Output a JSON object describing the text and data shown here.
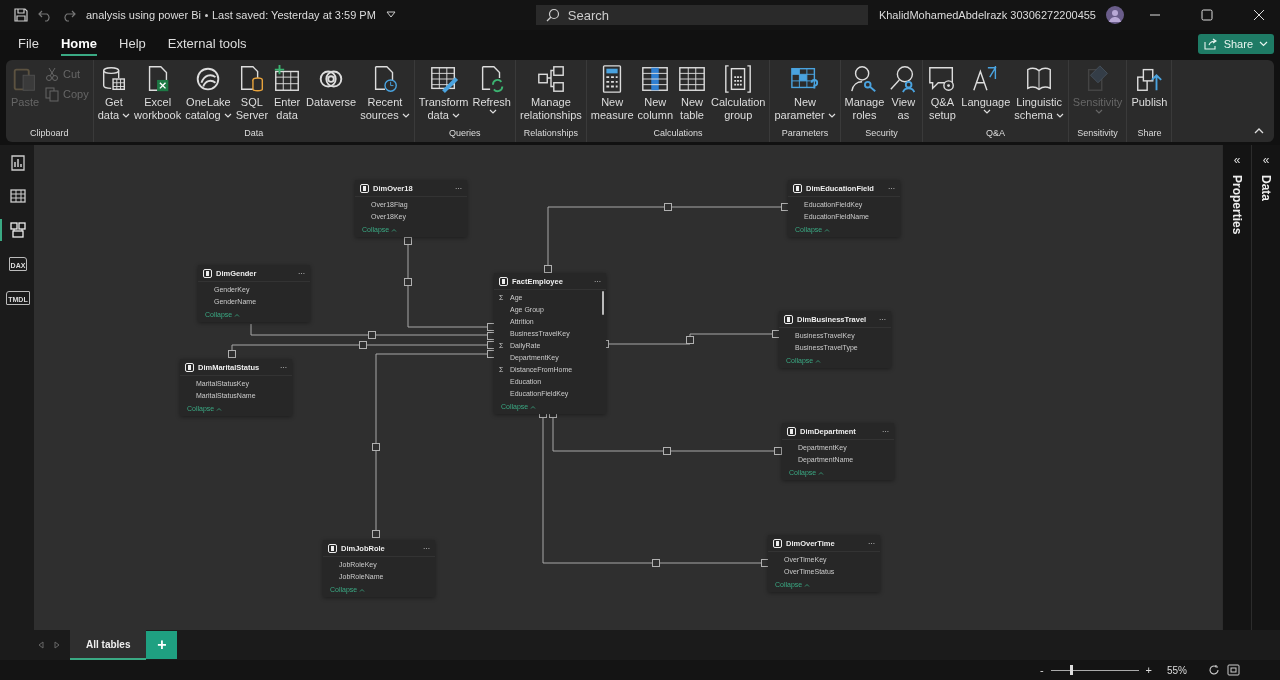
{
  "title_bar": {
    "document": "analysis using power Bi",
    "saved": "Last saved: Yesterday at 3:59 PM",
    "search": {
      "placeholder": "Search"
    },
    "user": "KhalidMohamedAbdelrazk 30306272200455"
  },
  "menu": [
    {
      "label": "File",
      "selected": false
    },
    {
      "label": "Home",
      "selected": true
    },
    {
      "label": "Help",
      "selected": false
    },
    {
      "label": "External tools",
      "selected": false
    }
  ],
  "share": "Share",
  "ribbon": [
    {
      "label": "Clipboard",
      "buttons": [
        {
          "kind": "paste",
          "lines": [
            "Paste"
          ],
          "caret": false,
          "disabled": true
        }
      ],
      "small_buttons": [
        {
          "kind": "cut",
          "label": "Cut",
          "disabled": true
        },
        {
          "kind": "copy",
          "label": "Copy",
          "disabled": true
        }
      ]
    },
    {
      "label": "Data",
      "buttons": [
        {
          "kind": "getdata",
          "lines": [
            "Get",
            "data"
          ],
          "caret": true,
          "disabled": false
        },
        {
          "kind": "excel",
          "lines": [
            "Excel",
            "workbook"
          ],
          "caret": false,
          "disabled": false
        },
        {
          "kind": "onelake",
          "lines": [
            "OneLake",
            "catalog"
          ],
          "caret": true,
          "disabled": false
        },
        {
          "kind": "sql",
          "lines": [
            "SQL",
            "Server"
          ],
          "caret": false,
          "disabled": false
        },
        {
          "kind": "enter",
          "lines": [
            "Enter",
            "data"
          ],
          "caret": false,
          "disabled": false
        },
        {
          "kind": "dataverse",
          "lines": [
            "Dataverse"
          ],
          "caret": false,
          "disabled": false
        },
        {
          "kind": "recent",
          "lines": [
            "Recent",
            "sources"
          ],
          "caret": true,
          "disabled": false
        }
      ]
    },
    {
      "label": "Queries",
      "buttons": [
        {
          "kind": "transform",
          "lines": [
            "Transform",
            "data"
          ],
          "caret": true,
          "disabled": false
        },
        {
          "kind": "refresh",
          "lines": [
            "Refresh"
          ],
          "caret": true,
          "disabled": false
        }
      ]
    },
    {
      "label": "Relationships",
      "buttons": [
        {
          "kind": "relationships",
          "lines": [
            "Manage",
            "relationships"
          ],
          "caret": false,
          "disabled": false
        }
      ]
    },
    {
      "label": "Calculations",
      "buttons": [
        {
          "kind": "measure",
          "lines": [
            "New",
            "measure"
          ],
          "caret": false,
          "disabled": false
        },
        {
          "kind": "column",
          "lines": [
            "New",
            "column"
          ],
          "caret": false,
          "disabled": false
        },
        {
          "kind": "table",
          "lines": [
            "New",
            "table"
          ],
          "caret": false,
          "disabled": false
        },
        {
          "kind": "calcgroup",
          "lines": [
            "Calculation",
            "group"
          ],
          "caret": false,
          "disabled": false
        }
      ]
    },
    {
      "label": "Parameters",
      "buttons": [
        {
          "kind": "parameter",
          "lines": [
            "New",
            "parameter"
          ],
          "caret": true,
          "disabled": false
        }
      ]
    },
    {
      "label": "Security",
      "buttons": [
        {
          "kind": "roles",
          "lines": [
            "Manage",
            "roles"
          ],
          "caret": false,
          "disabled": false
        },
        {
          "kind": "viewas",
          "lines": [
            "View",
            "as"
          ],
          "caret": false,
          "disabled": false
        }
      ]
    },
    {
      "label": "Q&A",
      "buttons": [
        {
          "kind": "qa",
          "lines": [
            "Q&A",
            "setup"
          ],
          "caret": false,
          "disabled": false
        },
        {
          "kind": "language",
          "lines": [
            "Language"
          ],
          "caret": true,
          "disabled": false
        },
        {
          "kind": "linguistic",
          "lines": [
            "Linguistic",
            "schema"
          ],
          "caret": true,
          "disabled": false
        }
      ]
    },
    {
      "label": "Sensitivity",
      "buttons": [
        {
          "kind": "sensitivity",
          "lines": [
            "Sensitivity"
          ],
          "caret": true,
          "disabled": true
        }
      ]
    },
    {
      "label": "Share",
      "buttons": [
        {
          "kind": "publish",
          "lines": [
            "Publish"
          ],
          "caret": false,
          "disabled": false
        }
      ]
    }
  ],
  "sidebar": [
    {
      "kind": "report",
      "selected": false
    },
    {
      "kind": "table",
      "selected": false
    },
    {
      "kind": "model",
      "selected": true
    },
    {
      "kind": "dax",
      "label": "DAX",
      "selected": false
    },
    {
      "kind": "tmdl",
      "label": "TMDL",
      "selected": false
    }
  ],
  "tables": [
    {
      "name": "DimOver18",
      "more": "···",
      "columns": [
        {
          "name": "Over18Flag"
        },
        {
          "name": "Over18Key"
        }
      ],
      "collapse": "Collapse"
    },
    {
      "name": "DimEducationField",
      "more": "···",
      "columns": [
        {
          "name": "EducationFieldKey"
        },
        {
          "name": "EducationFieldName"
        }
      ],
      "collapse": "Collapse"
    },
    {
      "name": "DimGender",
      "more": "···",
      "columns": [
        {
          "name": "GenderKey"
        },
        {
          "name": "GenderName"
        }
      ],
      "collapse": "Collapse"
    },
    {
      "name": "FactEmployee",
      "more": "···",
      "columns": [
        {
          "name": "Age",
          "prefix": "Σ"
        },
        {
          "name": "Age Group"
        },
        {
          "name": "Attrition"
        },
        {
          "name": "BusinessTravelKey"
        },
        {
          "name": "DailyRate",
          "prefix": "Σ"
        },
        {
          "name": "DepartmentKey"
        },
        {
          "name": "DistanceFromHome",
          "prefix": "Σ"
        },
        {
          "name": "Education"
        },
        {
          "name": "EducationFieldKey"
        }
      ],
      "collapse": "Collapse"
    },
    {
      "name": "DimBusinessTravel",
      "more": "···",
      "columns": [
        {
          "name": "BusinessTravelKey"
        },
        {
          "name": "BusinessTravelType"
        }
      ],
      "collapse": "Collapse"
    },
    {
      "name": "DimMaritalStatus",
      "more": "···",
      "columns": [
        {
          "name": "MaritalStatusKey"
        },
        {
          "name": "MaritalStatusName"
        }
      ],
      "collapse": "Collapse"
    },
    {
      "name": "DimDepartment",
      "more": "···",
      "columns": [
        {
          "name": "DepartmentKey"
        },
        {
          "name": "DepartmentName"
        }
      ],
      "collapse": "Collapse"
    },
    {
      "name": "DimJobRole",
      "more": "···",
      "columns": [
        {
          "name": "JobRoleKey"
        },
        {
          "name": "JobRoleName"
        }
      ],
      "collapse": "Collapse"
    },
    {
      "name": "DimOverTime",
      "more": "···",
      "columns": [
        {
          "name": "OverTimeKey"
        },
        {
          "name": "OverTimeStatus"
        }
      ],
      "collapse": "Collapse"
    }
  ],
  "panes": [
    {
      "label": "Properties",
      "chevron": "«"
    },
    {
      "label": "Data",
      "chevron": "«"
    }
  ],
  "page_tabs": [
    {
      "label": "All tables",
      "selected": true
    }
  ],
  "add_tab": "+",
  "zoom": {
    "minus": "-",
    "plus": "+",
    "level": 0.23,
    "reading": "55%"
  }
}
